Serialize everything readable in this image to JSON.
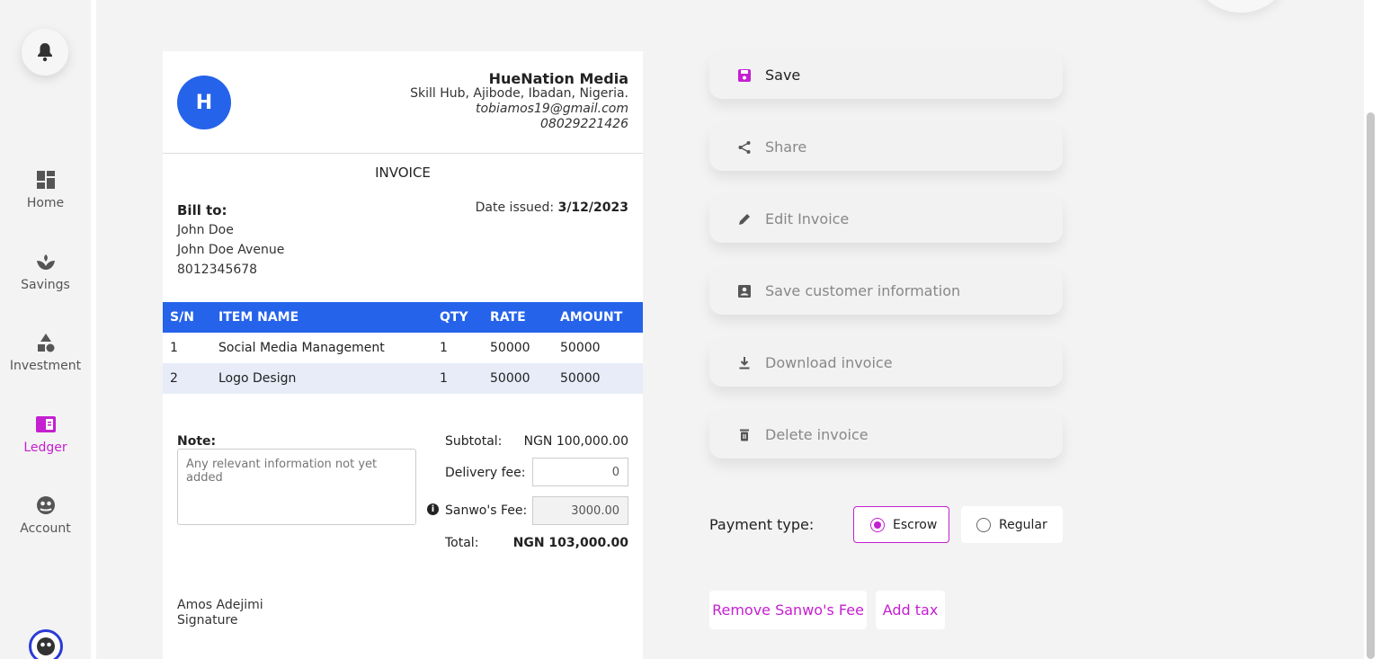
{
  "sidebar": {
    "items": [
      {
        "label": "Home",
        "icon": "grid-icon"
      },
      {
        "label": "Savings",
        "icon": "savings-icon"
      },
      {
        "label": "Investment",
        "icon": "shapes-icon"
      },
      {
        "label": "Ledger",
        "icon": "ledger-icon",
        "active": true
      },
      {
        "label": "Account",
        "icon": "account-icon"
      }
    ]
  },
  "invoice": {
    "logo_letter": "H",
    "business": {
      "name": "HueNation Media",
      "address": "Skill Hub, Ajibode, Ibadan, Nigeria.",
      "email": "tobiamos19@gmail.com",
      "phone": "08029221426"
    },
    "title": "INVOICE",
    "bill_to_label": "Bill to:",
    "customer": {
      "name": "John Doe",
      "address": "John Doe Avenue",
      "phone": "8012345678"
    },
    "date_label": "Date issued:",
    "date_value": "3/12/2023",
    "columns": [
      "S/N",
      "ITEM NAME",
      "QTY",
      "RATE",
      "AMOUNT"
    ],
    "rows": [
      [
        "1",
        "Social Media Management",
        "1",
        "50000",
        "50000"
      ],
      [
        "2",
        "Logo Design",
        "1",
        "50000",
        "50000"
      ]
    ],
    "note_label": "Note:",
    "note_placeholder": "Any relevant information not yet added",
    "subtotal_label": "Subtotal:",
    "subtotal_value": "NGN 100,000.00",
    "delivery_label": "Delivery fee:",
    "delivery_value": "0",
    "sanwo_label": "Sanwo's Fee:",
    "sanwo_value": "3000.00",
    "total_label": "Total:",
    "total_value": "NGN 103,000.00",
    "signer_name": "Amos Adejimi",
    "signature_label": "Signature"
  },
  "actions": {
    "save": "Save",
    "share": "Share",
    "edit": "Edit Invoice",
    "save_customer": "Save customer information",
    "download": "Download invoice",
    "delete": "Delete invoice"
  },
  "payment": {
    "label": "Payment type:",
    "options": [
      "Escrow",
      "Regular"
    ],
    "selected": "Escrow"
  },
  "links": {
    "remove_fee": "Remove Sanwo's Fee",
    "add_tax": "Add tax"
  },
  "colors": {
    "accent": "#c41fd1",
    "primary": "#2563eb"
  }
}
